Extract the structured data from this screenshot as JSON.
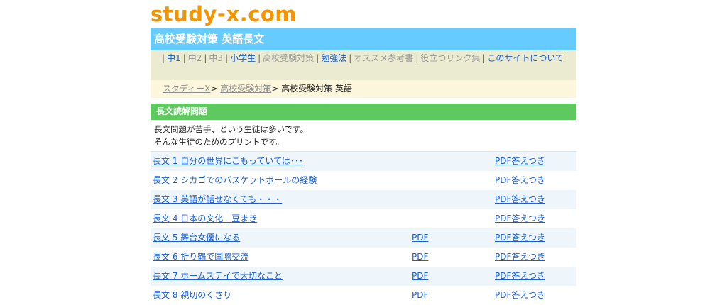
{
  "site": {
    "logo": "study-x.com"
  },
  "header": {
    "title": "高校受験対策 英語長文"
  },
  "nav": {
    "items": [
      {
        "label": "中1"
      },
      {
        "label": "中2"
      },
      {
        "label": "中3"
      },
      {
        "label": "小学生"
      },
      {
        "label": "高校受験対策"
      },
      {
        "label": "勉強法"
      },
      {
        "label": "オススメ参考書"
      },
      {
        "label": "役立つリンク集"
      },
      {
        "label": "このサイトについて"
      }
    ]
  },
  "breadcrumb": {
    "home": "スタディーX",
    "sep": ">",
    "parent": "高校受験対策",
    "current": "高校受験対策 英語"
  },
  "section": {
    "heading": "長文読解問題",
    "intro_line1": "長文問題が苦手、という生徒は多いです。",
    "intro_line2": "そんな生徒のためのプリントです。"
  },
  "rows": [
    {
      "title": "長文 1 自分の世界にこもっていては･･･",
      "pdf": "",
      "answer": "PDF答えつき"
    },
    {
      "title": "長文 2 シカゴでのバスケットボールの経験",
      "pdf": "",
      "answer": "PDF答えつき"
    },
    {
      "title": "長文 3 英語が話せなくても・・・",
      "pdf": "",
      "answer": "PDF答えつき"
    },
    {
      "title": "長文 4 日本の文化　豆まき",
      "pdf": "",
      "answer": "PDF答えつき"
    },
    {
      "title": "長文 5 舞台女優になる",
      "pdf": "PDF",
      "answer": "PDF答えつき"
    },
    {
      "title": "長文 6 折り鶴で国際交流",
      "pdf": "PDF",
      "answer": "PDF答えつき"
    },
    {
      "title": "長文 7 ホームステイで大切なこと",
      "pdf": "PDF",
      "answer": "PDF答えつき"
    },
    {
      "title": "長文 8 親切のくさり",
      "pdf": "PDF",
      "answer": "PDF答えつき"
    }
  ],
  "colors": {
    "logo": "#f29500",
    "title_bar": "#66ccff",
    "nav_bg": "#ebebd2",
    "crumb_bg": "#fbf6dc",
    "section_head": "#5ec95e",
    "link": "#1a5fd0",
    "row_alt": "#eef6fc"
  }
}
